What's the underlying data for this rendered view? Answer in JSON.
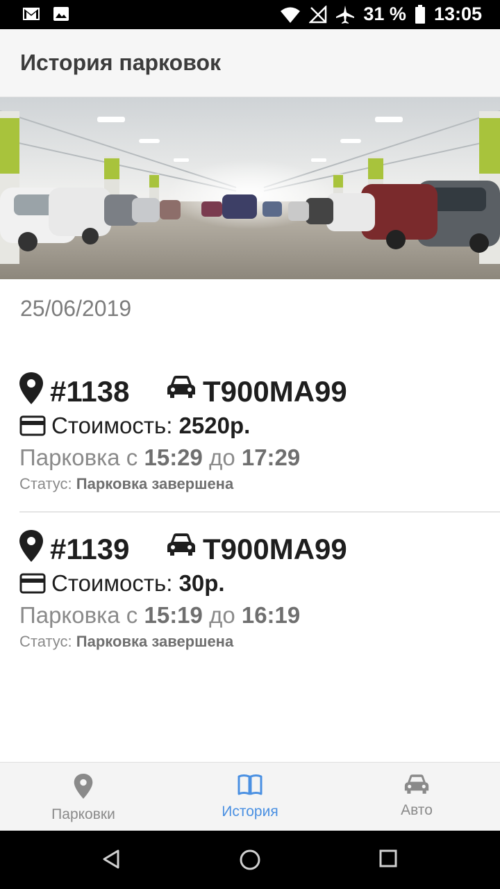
{
  "status_bar": {
    "battery": "31 %",
    "time": "13:05",
    "icons": [
      "gmail-icon",
      "image-icon",
      "wifi-icon",
      "no-sim-icon",
      "airplane-icon",
      "battery-icon"
    ]
  },
  "app_bar": {
    "title": "История парковок"
  },
  "hero": {
    "image": "parking-garage-photo"
  },
  "date": "25/06/2019",
  "parkings": [
    {
      "id": "#1138",
      "plate": "Т900МА99",
      "cost_label": "Стоимость:",
      "cost_value": "2520р.",
      "period_prefix": "Парковка с",
      "time_from": "15:29",
      "period_mid": "до",
      "time_to": "17:29",
      "status_label": "Статус:",
      "status_value": "Парковка завершена"
    },
    {
      "id": "#1139",
      "plate": "Т900МА99",
      "cost_label": "Стоимость:",
      "cost_value": "30р.",
      "period_prefix": "Парковка с",
      "time_from": "15:19",
      "period_mid": "до",
      "time_to": "16:19",
      "status_label": "Статус:",
      "status_value": "Парковка завершена"
    }
  ],
  "bottom_nav": {
    "items": [
      {
        "label": "Парковки",
        "icon": "map-pin-icon",
        "active": false
      },
      {
        "label": "История",
        "icon": "book-icon",
        "active": true
      },
      {
        "label": "Авто",
        "icon": "car-icon",
        "active": false
      }
    ]
  },
  "colors": {
    "accent": "#4a90e2",
    "inactive": "#8a8a8a",
    "app_bar_bg": "#f6f6f6",
    "text_dark": "#1e1e1e"
  }
}
